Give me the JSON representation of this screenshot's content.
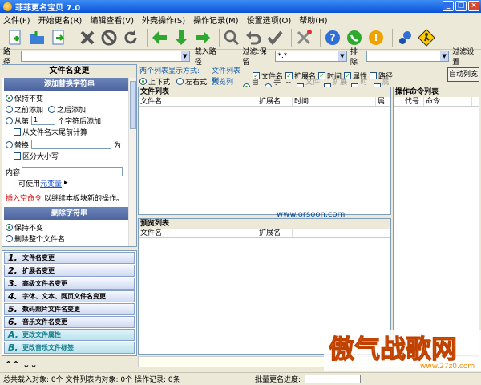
{
  "window": {
    "title": "菲菲更名宝贝 7.0"
  },
  "menu": [
    "文件(F)",
    "开始更名(R)",
    "编辑查看(V)",
    "外壳操作(S)",
    "操作记录(M)",
    "设置选项(O)",
    "帮助(H)"
  ],
  "toolbar": {
    "icons": [
      "add-file-icon",
      "open-folder-icon",
      "export-icon",
      "delete-icon",
      "stop-icon",
      "refresh-icon",
      "arrow-left-icon",
      "arrow-down-icon",
      "arrow-right-icon",
      "search-icon",
      "undo-icon",
      "checkmark-icon",
      "tools-icon",
      "help-icon",
      "phone-icon",
      "info-icon",
      "weather-icon",
      "run-icon"
    ]
  },
  "pathbar": {
    "path_label": "路径",
    "load_path": "载入路径",
    "filter_label": "过滤:保留",
    "filter_value": "*.*",
    "exclude_label": "排除",
    "filter_settings": "过滤设置"
  },
  "left": {
    "panel_title": "文件名变更",
    "sec1": "添加替换字符串",
    "keep": "保持不变",
    "before_add": "之前添加",
    "after_add": "之后添加",
    "from_nth": "从第",
    "nth_value": "1",
    "nth_suffix": "个字符后添加",
    "from_end": "从文件名末尾前计算",
    "replace": "替换",
    "replace_as": "为",
    "case": "区分大小写",
    "content_label": "内容",
    "can_use": "可使用",
    "meta_link": "元变量",
    "insert_null": "插入空命令",
    "insert_null_desc": "以继续本板块新的操作。",
    "sec2": "删除字符串",
    "keep2": "保持不变",
    "del_all": "删除整个文件名"
  },
  "tasks": [
    {
      "num": "1.",
      "label": "文件名变更"
    },
    {
      "num": "2.",
      "label": "扩展名变更"
    },
    {
      "num": "3.",
      "label": "高级文件名变更"
    },
    {
      "num": "4.",
      "label": "字体、文本、网页文件名变更"
    },
    {
      "num": "5.",
      "label": "数码照片文件名变更"
    },
    {
      "num": "6.",
      "label": "音乐文件名变更"
    },
    {
      "num": "A.",
      "label": "更改文件属性"
    },
    {
      "num": "B.",
      "label": "更改音乐文件标签"
    }
  ],
  "options": {
    "two_list_mode": "两个列表显示方式:",
    "up_down": "上下式",
    "left_right": "左右式",
    "file_list_show": "文件列表列:",
    "preview_list_show": "预览列表列:",
    "col_filename": "文件名",
    "col_ext": "扩展名",
    "col_time": "时间",
    "col_attr": "属性",
    "col_path": "路径",
    "auto": "自动",
    "manual": "手动",
    "arrow": "-->",
    "p_filename": "文件名",
    "p_ext": "扩展名",
    "p_time": "时间",
    "p_attr": "属性",
    "auto_button": "自动列宽"
  },
  "file_list": {
    "title": "文件列表",
    "cols": [
      "文件名",
      "扩展名",
      "时间",
      "属"
    ]
  },
  "preview_list": {
    "title": "预览列表",
    "cols": [
      "文件名",
      "扩展名"
    ]
  },
  "watermark": "www.orsoon.com",
  "cmd_list": {
    "title": "操作命令列表",
    "cols": [
      "代号",
      "命令"
    ]
  },
  "status": {
    "text": "总共载入对象: 0个  文件列表内对象: 0个  操作记录: 0条",
    "progress": "批量更名进度:"
  },
  "logo": {
    "text": "傲气战歌网",
    "sub": "www.27z0.com"
  }
}
